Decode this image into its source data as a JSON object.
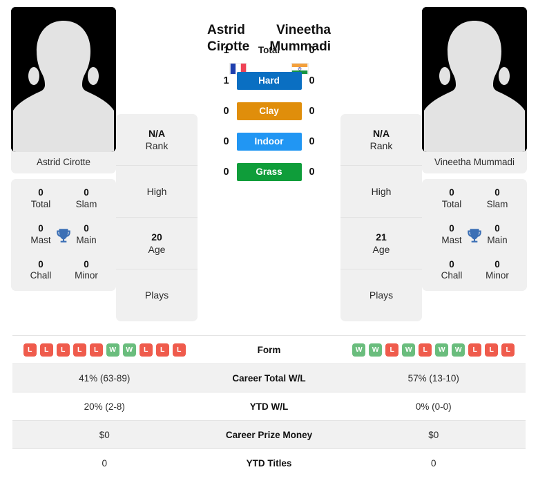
{
  "players": {
    "left": {
      "name": "Astrid Cirotte",
      "photo_name": "Astrid Cirotte",
      "country": "France",
      "flag_icon": "flag-france-icon",
      "rank_value": "N/A",
      "rank_label": "Rank",
      "high_value": "",
      "high_label": "High",
      "age_value": "20",
      "age_label": "Age",
      "plays_value": "",
      "plays_label": "Plays",
      "titles": [
        {
          "value": "0",
          "label": "Total"
        },
        {
          "value": "0",
          "label": "Slam"
        },
        {
          "value": "0",
          "label": "Mast"
        },
        {
          "value": "0",
          "label": "Main"
        },
        {
          "value": "0",
          "label": "Chall"
        },
        {
          "value": "0",
          "label": "Minor"
        }
      ],
      "form": [
        "L",
        "L",
        "L",
        "L",
        "L",
        "W",
        "W",
        "L",
        "L",
        "L"
      ],
      "career_total_wl": "41% (63-89)",
      "ytd_wl": "20% (2-8)",
      "career_prize_money": "$0",
      "ytd_titles": "0"
    },
    "right": {
      "name": "Vineetha Mummadi",
      "photo_name": "Vineetha Mummadi",
      "country": "India",
      "flag_icon": "flag-india-icon",
      "rank_value": "N/A",
      "rank_label": "Rank",
      "high_value": "",
      "high_label": "High",
      "age_value": "21",
      "age_label": "Age",
      "plays_value": "",
      "plays_label": "Plays",
      "titles": [
        {
          "value": "0",
          "label": "Total"
        },
        {
          "value": "0",
          "label": "Slam"
        },
        {
          "value": "0",
          "label": "Mast"
        },
        {
          "value": "0",
          "label": "Main"
        },
        {
          "value": "0",
          "label": "Chall"
        },
        {
          "value": "0",
          "label": "Minor"
        }
      ],
      "form": [
        "W",
        "W",
        "L",
        "W",
        "L",
        "W",
        "W",
        "L",
        "L",
        "L"
      ],
      "career_total_wl": "57% (13-10)",
      "ytd_wl": "0% (0-0)",
      "career_prize_money": "$0",
      "ytd_titles": "0"
    }
  },
  "head_to_head": [
    {
      "label": "Total",
      "left": "1",
      "right": "0",
      "color": "",
      "plain": true
    },
    {
      "label": "Hard",
      "left": "1",
      "right": "0",
      "color": "#0a6fc2",
      "plain": false
    },
    {
      "label": "Clay",
      "left": "0",
      "right": "0",
      "color": "#e08e0b",
      "plain": false
    },
    {
      "label": "Indoor",
      "left": "0",
      "right": "0",
      "color": "#2196f3",
      "plain": false
    },
    {
      "label": "Grass",
      "left": "0",
      "right": "0",
      "color": "#0f9d3a",
      "plain": false
    }
  ],
  "comparison_rows": [
    {
      "label": "Form",
      "type": "form",
      "shaded": false
    },
    {
      "label": "Career Total W/L",
      "type": "text",
      "shaded": true,
      "key": "career_total_wl"
    },
    {
      "label": "YTD W/L",
      "type": "text",
      "shaded": false,
      "key": "ytd_wl"
    },
    {
      "label": "Career Prize Money",
      "type": "text",
      "shaded": true,
      "key": "career_prize_money"
    },
    {
      "label": "YTD Titles",
      "type": "text",
      "shaded": false,
      "key": "ytd_titles"
    }
  ],
  "colors": {
    "win_badge": "#6abd7d",
    "loss_badge": "#ef5b4c",
    "trophy": "#3b6fb5",
    "card_bg": "#f0f0f0",
    "row_shade": "#f1f1f1"
  },
  "icons": {
    "trophy": "trophy-icon",
    "avatar": "avatar-placeholder-icon"
  }
}
